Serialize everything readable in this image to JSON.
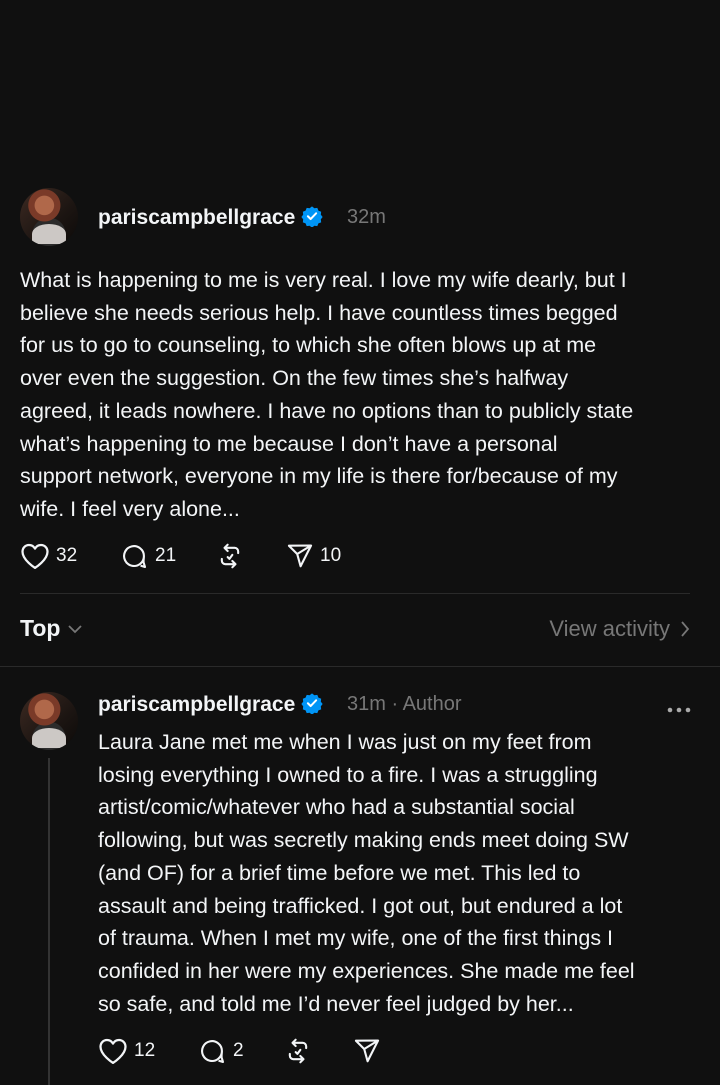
{
  "post": {
    "username": "pariscampbellgrace",
    "time": "32m",
    "text": "What is happening to me is very real. I love my wife dearly, but I\nbelieve she needs serious help. I have countless times begged\nfor us to go to counseling, to which she often blows up at me\nover even the suggestion. On the few times she’s halfway\nagreed, it leads nowhere. I have no options than to publicly state\nwhat’s happening to me because I don’t have a personal\nsupport network, everyone in my life is there for/because of my\nwife. I feel very alone...",
    "likes": "32",
    "replies": "21",
    "shares": "10"
  },
  "sort": {
    "label": "Top",
    "view_activity": "View activity"
  },
  "reply": {
    "username": "pariscampbellgrace",
    "time": "31m",
    "author_label": "· Author",
    "text": "Laura Jane met me when I was just on my feet from\nlosing everything I owned to a fire. I was a struggling\nartist/comic/whatever who had a substantial social\nfollowing, but was secretly making ends meet doing SW\n(and OF) for a brief time before we met. This led to\nassault and being trafficked. I got out, but endured a lot\nof trauma. When I met my wife, one of the first things I\nconfided in her were my experiences. She made me feel\nso safe, and told me I’d never feel judged by her...",
    "likes": "12",
    "replies": "2"
  },
  "colors": {
    "background": "#101010",
    "verified": "#0095f6",
    "muted": "#777777"
  },
  "icons": [
    "verified-badge-icon",
    "heart-icon",
    "comment-icon",
    "repost-icon",
    "send-icon",
    "chevron-down-icon",
    "chevron-right-icon",
    "more-icon"
  ]
}
